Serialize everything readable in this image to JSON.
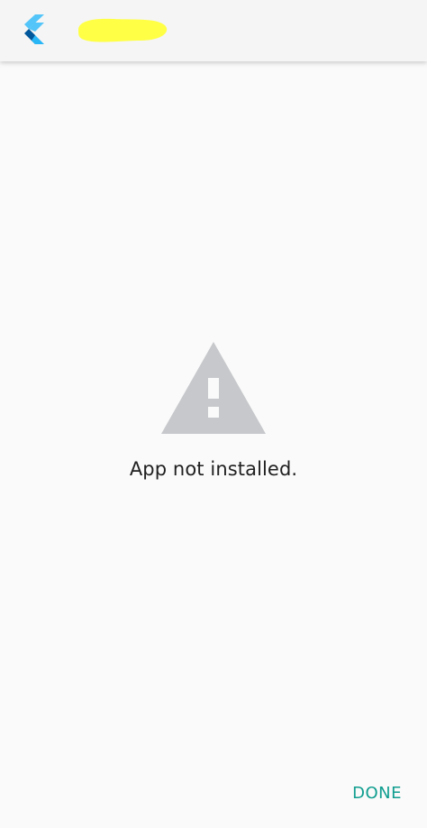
{
  "app_bar": {
    "logo_icon": "flutter-icon"
  },
  "main": {
    "message": "App not installed.",
    "warning_icon": "warning-triangle-icon"
  },
  "actions": {
    "done_label": "DONE"
  },
  "colors": {
    "accent": "#0f9d8f",
    "icon_gray": "#c6c8cb",
    "logo_blue_light": "#54c5f8",
    "logo_blue_dark": "#01579b",
    "redaction_yellow": "#ffff45"
  }
}
